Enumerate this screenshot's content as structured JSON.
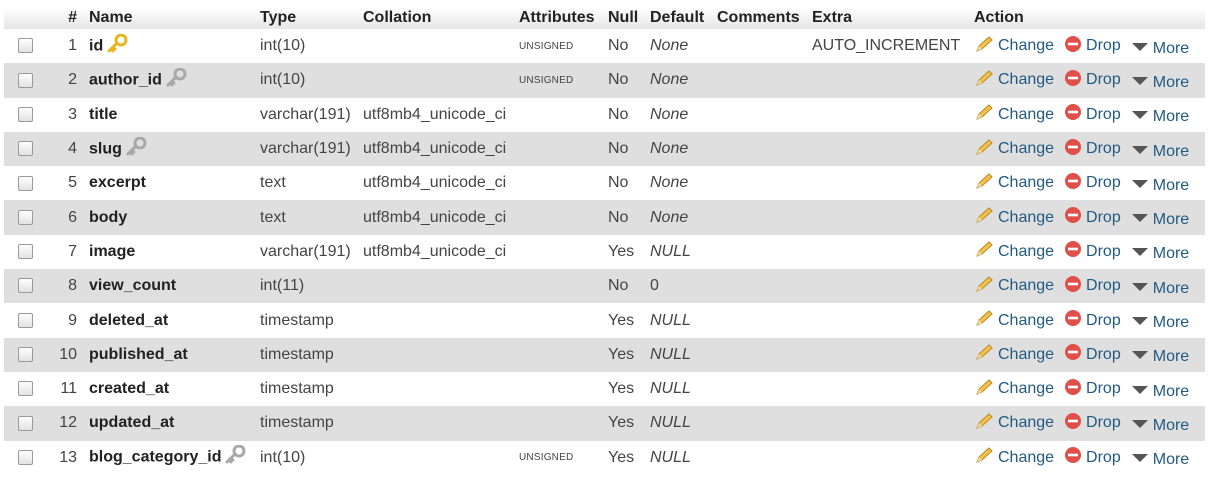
{
  "headers": {
    "num": "#",
    "name": "Name",
    "type": "Type",
    "collation": "Collation",
    "attributes": "Attributes",
    "null": "Null",
    "default": "Default",
    "comments": "Comments",
    "extra": "Extra",
    "action": "Action"
  },
  "actions": {
    "change": "Change",
    "drop": "Drop",
    "more": "More"
  },
  "columns": [
    {
      "num": "1",
      "name": "id",
      "key": "primary",
      "type": "int(10)",
      "collation": "",
      "attributes": "UNSIGNED",
      "null": "No",
      "default": "None",
      "default_italic": true,
      "comments": "",
      "extra": "AUTO_INCREMENT"
    },
    {
      "num": "2",
      "name": "author_id",
      "key": "index",
      "type": "int(10)",
      "collation": "",
      "attributes": "UNSIGNED",
      "null": "No",
      "default": "None",
      "default_italic": true,
      "comments": "",
      "extra": ""
    },
    {
      "num": "3",
      "name": "title",
      "key": "",
      "type": "varchar(191)",
      "collation": "utf8mb4_unicode_ci",
      "attributes": "",
      "null": "No",
      "default": "None",
      "default_italic": true,
      "comments": "",
      "extra": ""
    },
    {
      "num": "4",
      "name": "slug",
      "key": "index",
      "type": "varchar(191)",
      "collation": "utf8mb4_unicode_ci",
      "attributes": "",
      "null": "No",
      "default": "None",
      "default_italic": true,
      "comments": "",
      "extra": ""
    },
    {
      "num": "5",
      "name": "excerpt",
      "key": "",
      "type": "text",
      "collation": "utf8mb4_unicode_ci",
      "attributes": "",
      "null": "No",
      "default": "None",
      "default_italic": true,
      "comments": "",
      "extra": ""
    },
    {
      "num": "6",
      "name": "body",
      "key": "",
      "type": "text",
      "collation": "utf8mb4_unicode_ci",
      "attributes": "",
      "null": "No",
      "default": "None",
      "default_italic": true,
      "comments": "",
      "extra": ""
    },
    {
      "num": "7",
      "name": "image",
      "key": "",
      "type": "varchar(191)",
      "collation": "utf8mb4_unicode_ci",
      "attributes": "",
      "null": "Yes",
      "default": "NULL",
      "default_italic": true,
      "comments": "",
      "extra": ""
    },
    {
      "num": "8",
      "name": "view_count",
      "key": "",
      "type": "int(11)",
      "collation": "",
      "attributes": "",
      "null": "No",
      "default": "0",
      "default_italic": false,
      "comments": "",
      "extra": ""
    },
    {
      "num": "9",
      "name": "deleted_at",
      "key": "",
      "type": "timestamp",
      "collation": "",
      "attributes": "",
      "null": "Yes",
      "default": "NULL",
      "default_italic": true,
      "comments": "",
      "extra": ""
    },
    {
      "num": "10",
      "name": "published_at",
      "key": "",
      "type": "timestamp",
      "collation": "",
      "attributes": "",
      "null": "Yes",
      "default": "NULL",
      "default_italic": true,
      "comments": "",
      "extra": ""
    },
    {
      "num": "11",
      "name": "created_at",
      "key": "",
      "type": "timestamp",
      "collation": "",
      "attributes": "",
      "null": "Yes",
      "default": "NULL",
      "default_italic": true,
      "comments": "",
      "extra": ""
    },
    {
      "num": "12",
      "name": "updated_at",
      "key": "",
      "type": "timestamp",
      "collation": "",
      "attributes": "",
      "null": "Yes",
      "default": "NULL",
      "default_italic": true,
      "comments": "",
      "extra": ""
    },
    {
      "num": "13",
      "name": "blog_category_id",
      "key": "index",
      "type": "int(10)",
      "collation": "",
      "attributes": "UNSIGNED",
      "null": "Yes",
      "default": "NULL",
      "default_italic": true,
      "comments": "",
      "extra": ""
    }
  ],
  "colors": {
    "link": "#235a81",
    "row_alt": "#dfdfdf",
    "primary_key": "#e8b520",
    "index_key": "#a9a9a9",
    "drop_icon": "#e0504a"
  }
}
